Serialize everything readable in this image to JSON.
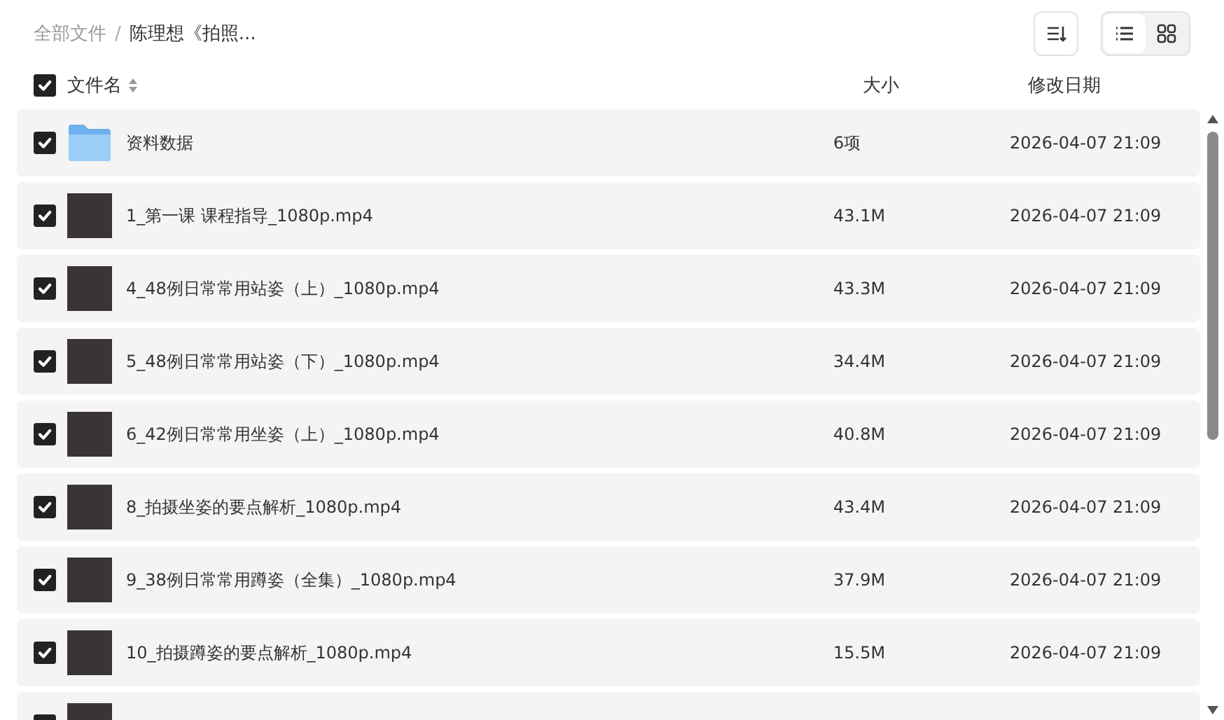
{
  "breadcrumb_separator": "/",
  "breadcrumb": [
    {
      "label": "全部文件",
      "current": false
    },
    {
      "label": "陈理想《拍照...",
      "current": true
    }
  ],
  "view_toggle": [
    {
      "kind": "list",
      "selected": true
    },
    {
      "kind": "grid",
      "selected": false
    }
  ],
  "header": {
    "checked": true,
    "columns": [
      "文件名",
      "大小",
      "修改日期"
    ]
  },
  "rows": [
    {
      "kind": "folder",
      "checked": true,
      "name": "资料数据",
      "size": "6项",
      "date": "2026-04-07 21:09"
    },
    {
      "kind": "video",
      "checked": true,
      "name": "1_第一课 课程指导_1080p.mp4",
      "size": "43.1M",
      "date": "2026-04-07 21:09"
    },
    {
      "kind": "video",
      "checked": true,
      "name": "4_48例日常常用站姿（上）_1080p.mp4",
      "size": "43.3M",
      "date": "2026-04-07 21:09"
    },
    {
      "kind": "video",
      "checked": true,
      "name": "5_48例日常常用站姿（下）_1080p.mp4",
      "size": "34.4M",
      "date": "2026-04-07 21:09"
    },
    {
      "kind": "video",
      "checked": true,
      "name": "6_42例日常常用坐姿（上）_1080p.mp4",
      "size": "40.8M",
      "date": "2026-04-07 21:09"
    },
    {
      "kind": "video",
      "checked": true,
      "name": "8_拍摄坐姿的要点解析_1080p.mp4",
      "size": "43.4M",
      "date": "2026-04-07 21:09"
    },
    {
      "kind": "video",
      "checked": true,
      "name": "9_38例日常常用蹲姿（全集）_1080p.mp4",
      "size": "37.9M",
      "date": "2026-04-07 21:09"
    },
    {
      "kind": "video",
      "checked": true,
      "name": "10_拍摄蹲姿的要点解析_1080p.mp4",
      "size": "15.5M",
      "date": "2026-04-07 21:09"
    },
    {
      "kind": "video",
      "checked": true
    }
  ]
}
